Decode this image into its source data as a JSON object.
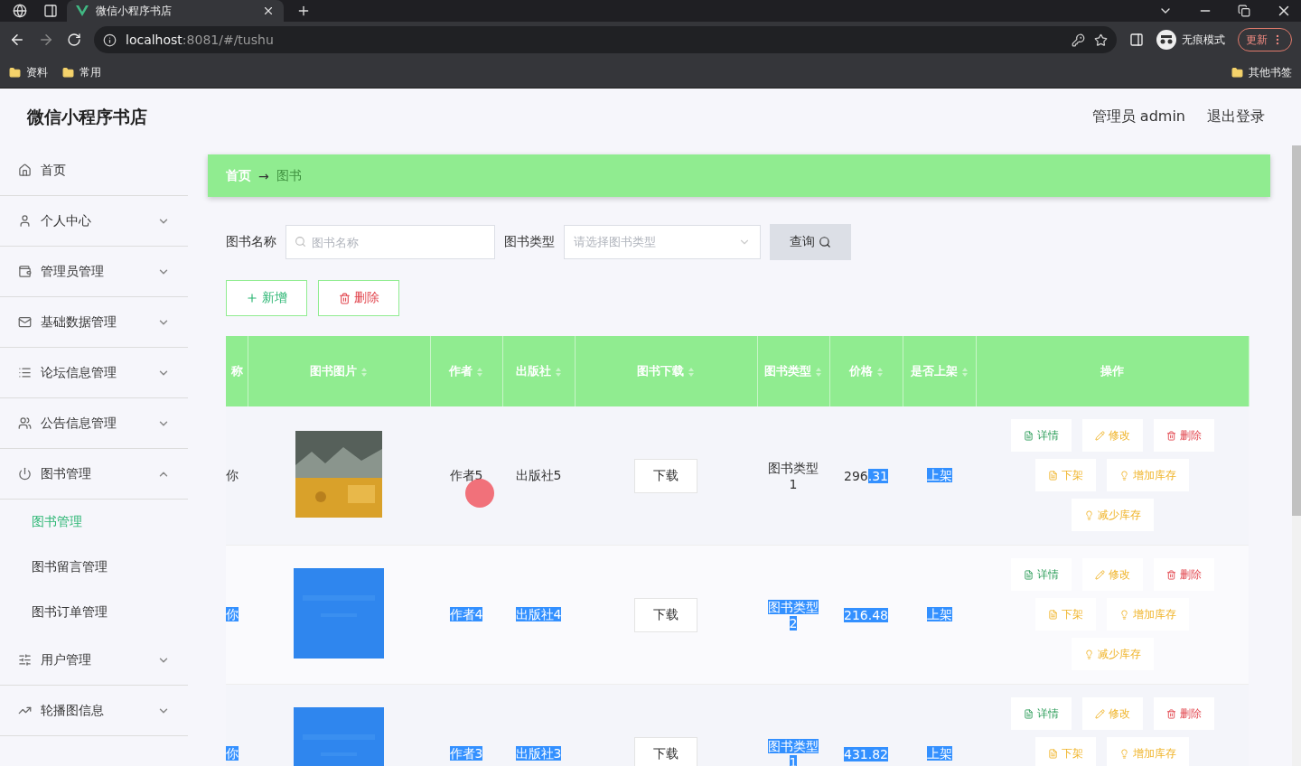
{
  "browser": {
    "tab_title": "微信小程序书店",
    "url_host": "localhost",
    "url_rest": ":8081/#/tushu",
    "bookmarks": [
      "资料",
      "常用"
    ],
    "other_bookmarks": "其他书签",
    "incognito": "无痕模式",
    "update": "更新"
  },
  "header": {
    "title": "微信小程序书店",
    "user": "管理员 admin",
    "logout": "退出登录"
  },
  "sidebar": {
    "items": [
      {
        "label": "首页",
        "kind": "link"
      },
      {
        "label": "个人中心",
        "kind": "menu",
        "expanded": false
      },
      {
        "label": "管理员管理",
        "kind": "menu",
        "expanded": false
      },
      {
        "label": "基础数据管理",
        "kind": "menu",
        "expanded": false
      },
      {
        "label": "论坛信息管理",
        "kind": "menu",
        "expanded": false
      },
      {
        "label": "公告信息管理",
        "kind": "menu",
        "expanded": false
      },
      {
        "label": "图书管理",
        "kind": "menu",
        "expanded": true,
        "children": [
          {
            "label": "图书管理",
            "selected": true
          },
          {
            "label": "图书留言管理",
            "selected": false
          },
          {
            "label": "图书订单管理",
            "selected": false
          }
        ]
      },
      {
        "label": "用户管理",
        "kind": "menu",
        "expanded": false
      },
      {
        "label": "轮播图信息",
        "kind": "menu",
        "expanded": false
      }
    ]
  },
  "breadcrumb": {
    "home": "首页",
    "separator": "→",
    "current": "图书"
  },
  "search": {
    "name_label": "图书名称",
    "name_placeholder": "图书名称",
    "type_label": "图书类型",
    "type_placeholder": "请选择图书类型",
    "query_button": "查询"
  },
  "actions": {
    "add": "新增",
    "delete": "删除"
  },
  "table": {
    "columns": [
      {
        "label": "称",
        "sortable": false
      },
      {
        "label": "图书图片",
        "sortable": true
      },
      {
        "label": "作者",
        "sortable": true
      },
      {
        "label": "出版社",
        "sortable": true
      },
      {
        "label": "图书下载",
        "sortable": true
      },
      {
        "label": "图书类型",
        "sortable": true
      },
      {
        "label": "价格",
        "sortable": true
      },
      {
        "label": "是否上架",
        "sortable": true
      },
      {
        "label": "操作",
        "sortable": false
      }
    ],
    "rows": [
      {
        "column_1": [
          {
            "text": "你",
            "highlighted": false
          }
        ],
        "image": {
          "kind": "picture",
          "highlighted": false
        },
        "author": [
          {
            "text": "作者5",
            "highlighted": false
          }
        ],
        "publisher": [
          {
            "text": "出版社5",
            "highlighted": false
          }
        ],
        "download": "下载",
        "type": [
          {
            "text": "图书类型1",
            "highlighted": false
          }
        ],
        "price": [
          {
            "text": "296",
            "highlighted": false
          },
          {
            "text": ".31",
            "highlighted": true
          }
        ],
        "on_shelf": [
          {
            "text": "上架",
            "highlighted": true
          }
        ],
        "ops": [
          {
            "label": "详情",
            "kind": "detail"
          },
          {
            "label": "修改",
            "kind": "edit"
          },
          {
            "label": "删除",
            "kind": "delete"
          },
          {
            "label": "下架",
            "kind": "off"
          },
          {
            "label": "增加库存",
            "kind": "stock"
          },
          {
            "label": "减少库存",
            "kind": "stock"
          }
        ]
      },
      {
        "column_1": [
          {
            "text": "你",
            "highlighted": true
          }
        ],
        "image": {
          "kind": "picture",
          "highlighted": true
        },
        "author": [
          {
            "text": "作者4",
            "highlighted": true
          }
        ],
        "publisher": [
          {
            "text": "出版社4",
            "highlighted": true
          }
        ],
        "download": "下载",
        "type": [
          {
            "text": "图书类型2",
            "highlighted": true
          }
        ],
        "price": [
          {
            "text": "216.48",
            "highlighted": true
          }
        ],
        "on_shelf": [
          {
            "text": "上架",
            "highlighted": true
          }
        ],
        "ops": [
          {
            "label": "详情",
            "kind": "detail"
          },
          {
            "label": "修改",
            "kind": "edit"
          },
          {
            "label": "删除",
            "kind": "delete"
          },
          {
            "label": "下架",
            "kind": "off"
          },
          {
            "label": "增加库存",
            "kind": "stock"
          },
          {
            "label": "减少库存",
            "kind": "stock"
          }
        ]
      },
      {
        "column_1": [
          {
            "text": "你",
            "highlighted": true
          }
        ],
        "image": {
          "kind": "picture",
          "highlighted": true
        },
        "author": [
          {
            "text": "作者3",
            "highlighted": true
          }
        ],
        "publisher": [
          {
            "text": "出版社3",
            "highlighted": true
          }
        ],
        "download": "下载",
        "type": [
          {
            "text": "图书类型1",
            "highlighted": true
          }
        ],
        "price": [
          {
            "text": "431.82",
            "highlighted": true
          }
        ],
        "on_shelf": [
          {
            "text": "上架",
            "highlighted": true
          }
        ],
        "ops": [
          {
            "label": "详情",
            "kind": "detail"
          },
          {
            "label": "修改",
            "kind": "edit"
          },
          {
            "label": "删除",
            "kind": "delete"
          },
          {
            "label": "下架",
            "kind": "off"
          },
          {
            "label": "增加库存",
            "kind": "stock"
          }
        ]
      }
    ]
  }
}
